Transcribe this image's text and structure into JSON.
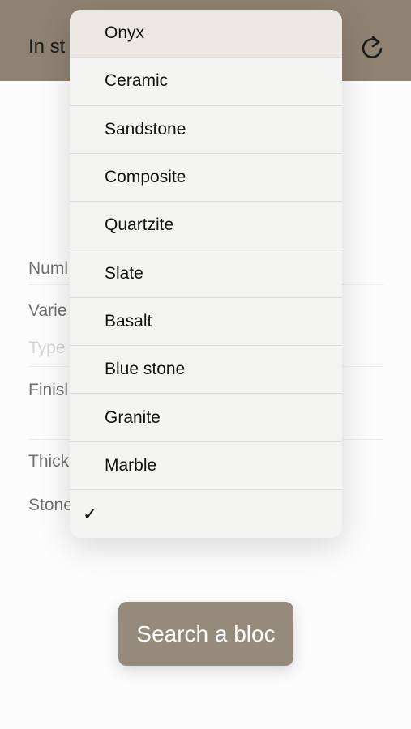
{
  "navbar": {
    "title": "In st",
    "refresh_icon": "refresh-icon",
    "color": "#8f8272"
  },
  "form": {
    "number_label": "Numl",
    "variety_label": "Varie",
    "variety_placeholder": "Type",
    "finish_label": "Finisl",
    "thickness_label": "Thick",
    "stone_label": "Stone"
  },
  "dropdown": {
    "items": [
      "Onyx",
      "Ceramic",
      "Sandstone",
      "Composite",
      "Quartzite",
      "Slate",
      "Basalt",
      "Blue stone",
      "Granite",
      "Marble",
      ""
    ],
    "selected_mark": "✓"
  },
  "search_button": {
    "label": "Search a bloc",
    "color": "#958a7c"
  }
}
